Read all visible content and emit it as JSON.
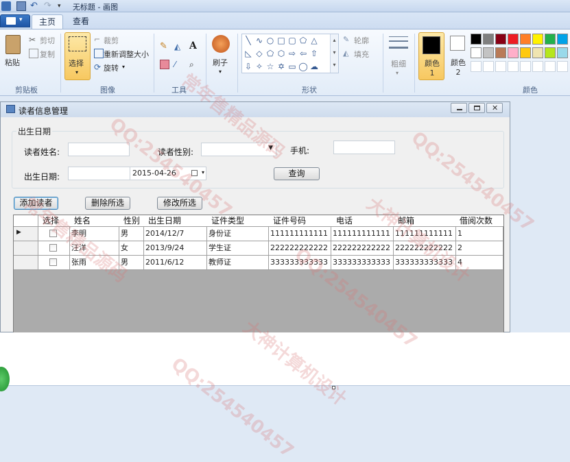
{
  "paint": {
    "title": "无标题 - 画图",
    "tabs": [
      "主页",
      "查看"
    ],
    "clipboard": {
      "paste": "粘贴",
      "cut": "剪切",
      "copy": "复制",
      "group": "剪贴板"
    },
    "image": {
      "select": "选择",
      "crop": "裁剪",
      "resize": "重新调整大小",
      "rotate": "旋转",
      "group": "图像"
    },
    "tools": {
      "group": "工具"
    },
    "brushes": {
      "label": "刷子"
    },
    "shapes": {
      "outline": "轮廓",
      "fill": "填充",
      "group": "形状"
    },
    "size": {
      "label": "粗细"
    },
    "colors": {
      "color1": "颜色 1",
      "color2": "颜色 2",
      "group": "颜色",
      "palette_row1": [
        "#000000",
        "#7f7f7f",
        "#880015",
        "#ed1c24",
        "#ff7f27",
        "#fff200",
        "#22b14c",
        "#00a2e8"
      ],
      "palette_row2": [
        "#ffffff",
        "#c3c3c3",
        "#b97a57",
        "#ffaec9",
        "#ffc90e",
        "#efe4b0",
        "#b5e61d",
        "#99d9ea"
      ]
    }
  },
  "window": {
    "title": "读者信息管理",
    "groupbox": "出生日期",
    "labels": {
      "name": "读者姓名:",
      "gender": "读者性别:",
      "phone": "手机:",
      "birth": "出生日期:"
    },
    "birth_date_value": "2015-04-26",
    "buttons": {
      "query": "查询",
      "add": "添加读者",
      "delete": "删除所选",
      "edit": "修改所选"
    }
  },
  "grid": {
    "columns": [
      "选择",
      "姓名",
      "性别",
      "出生日期",
      "证件类型",
      "证件号码",
      "电话",
      "邮箱",
      "借阅次数"
    ],
    "rows": [
      {
        "name": "李明",
        "gender": "男",
        "birth": "2014/12/7",
        "id_type": "身份证",
        "id_no": "111111111111",
        "phone": "111111111111",
        "email": "111111111111",
        "borrows": "1"
      },
      {
        "name": "汪洋",
        "gender": "女",
        "birth": "2013/9/24",
        "id_type": "学生证",
        "id_no": "222222222222",
        "phone": "222222222222",
        "email": "222222222222",
        "borrows": "2"
      },
      {
        "name": "张雨",
        "gender": "男",
        "birth": "2011/6/12",
        "id_type": "教师证",
        "id_no": "333333333333",
        "phone": "333333333333",
        "email": "333333333333",
        "borrows": "4"
      }
    ]
  },
  "watermarks": [
    "QQ:254540457",
    "大神计算机设计",
    "常年售精品源码"
  ]
}
